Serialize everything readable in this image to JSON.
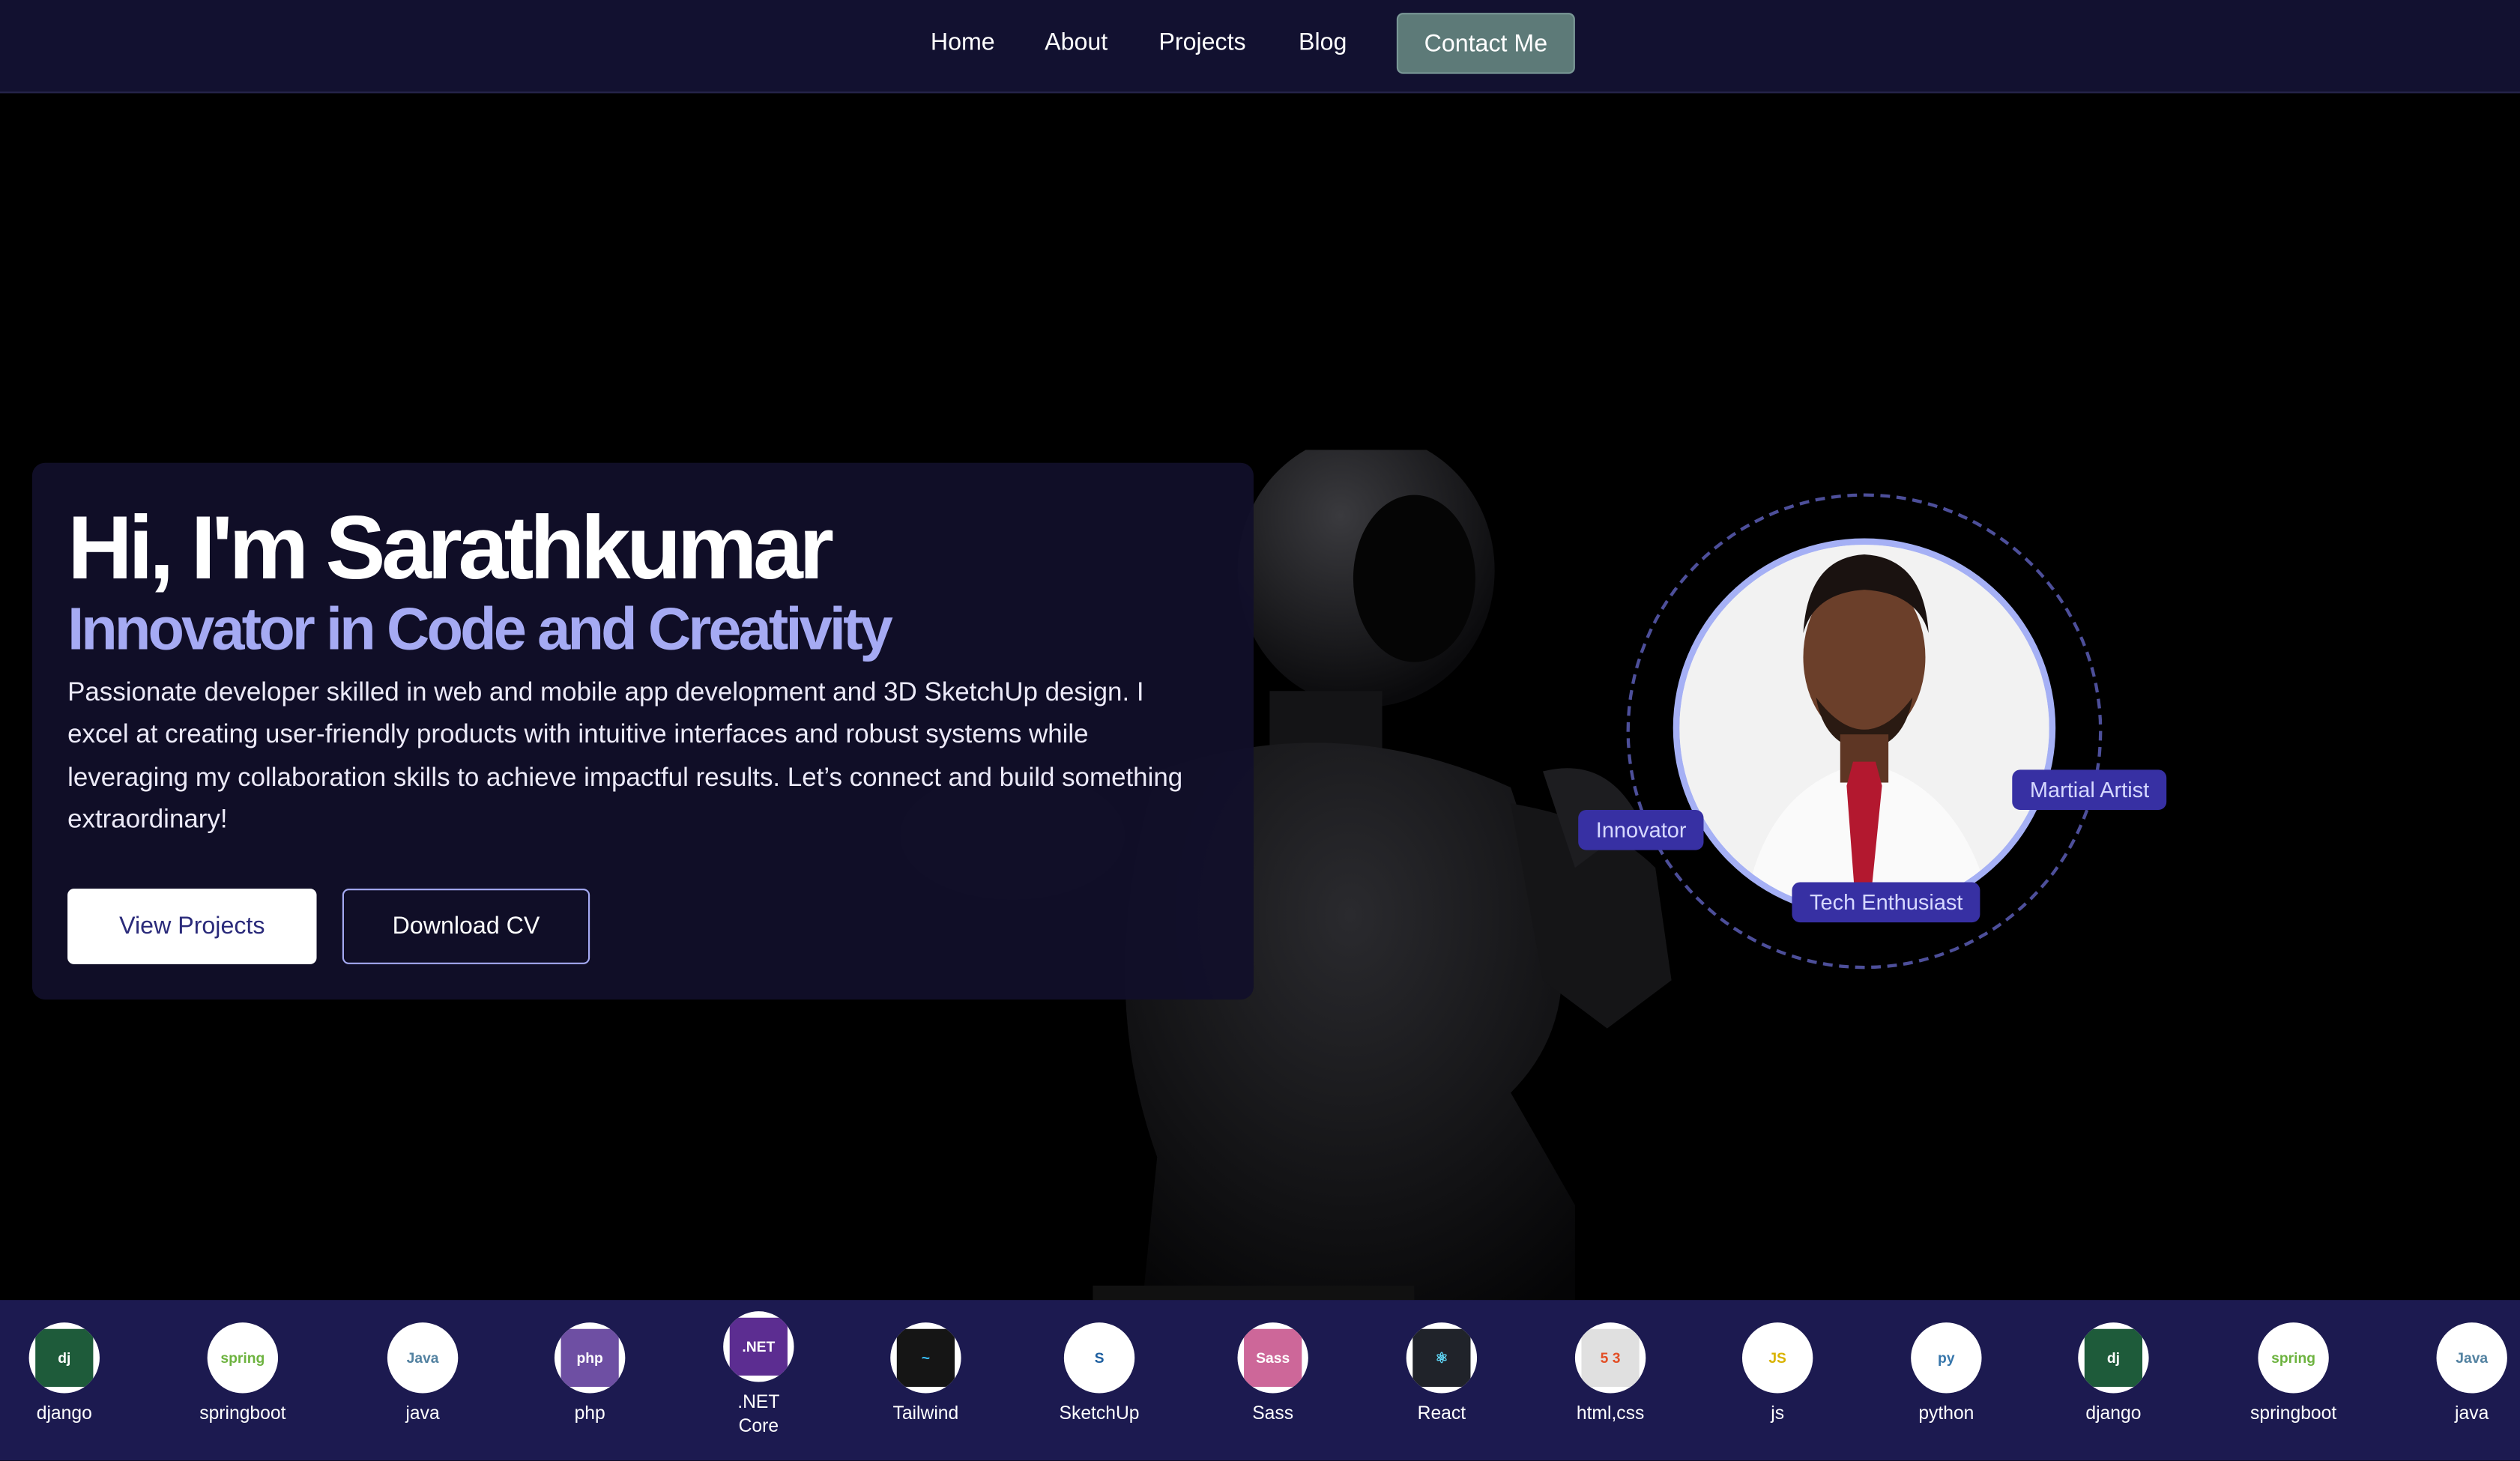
{
  "nav": {
    "items": [
      "Home",
      "About",
      "Projects",
      "Blog"
    ],
    "contact_label": "Contact Me"
  },
  "hero": {
    "title": "Hi, I'm Sarathkumar",
    "subtitle": "Innovator in Code and Creativity",
    "description": "Passionate developer skilled in web and mobile app development and 3D SketchUp design. I excel at creating user-friendly products with intuitive interfaces and robust systems while leveraging my collaboration skills to achieve impactful results. Let’s connect and build something extraordinary!",
    "view_projects_label": "View Projects",
    "download_cv_label": "Download CV"
  },
  "profile": {
    "badges": [
      "Innovator",
      "Tech Enthusiast",
      "Martial Artist"
    ]
  },
  "tech_stack": [
    {
      "label": "django",
      "icon": "django-icon",
      "mark": "dj",
      "bg": "#1e5b3a",
      "fg": "#ffffff"
    },
    {
      "label": "springboot",
      "icon": "springboot-icon",
      "mark": "spring",
      "bg": "#ffffff",
      "fg": "#6db33f"
    },
    {
      "label": "java",
      "icon": "java-icon",
      "mark": "Java",
      "bg": "#ffffff",
      "fg": "#5382a1"
    },
    {
      "label": "php",
      "icon": "php-icon",
      "mark": "php",
      "bg": "#6e4fa3",
      "fg": "#ffffff"
    },
    {
      "label": ".NET Core",
      "icon": "dotnet-icon",
      "mark": ".NET",
      "bg": "#5c2d91",
      "fg": "#ffffff"
    },
    {
      "label": "Tailwind",
      "icon": "tailwind-icon",
      "mark": "~",
      "bg": "#151515",
      "fg": "#38bdf8"
    },
    {
      "label": "SketchUp",
      "icon": "sketchup-icon",
      "mark": "S",
      "bg": "#ffffff",
      "fg": "#1e5fa0"
    },
    {
      "label": "Sass",
      "icon": "sass-icon",
      "mark": "Sass",
      "bg": "#cd6799",
      "fg": "#ffffff"
    },
    {
      "label": "React",
      "icon": "react-icon",
      "mark": "⚛",
      "bg": "#20232a",
      "fg": "#61dafb"
    },
    {
      "label": "html,css",
      "icon": "html-css-icon",
      "mark": "5 3",
      "bg": "#e0e0e0",
      "fg": "#e34f26"
    },
    {
      "label": "js",
      "icon": "javascript-icon",
      "mark": "JS",
      "bg": "#ffffff",
      "fg": "#d9b300"
    },
    {
      "label": "python",
      "icon": "python-icon",
      "mark": "py",
      "bg": "#ffffff",
      "fg": "#3776ab"
    },
    {
      "label": "django",
      "icon": "django-icon",
      "mark": "dj",
      "bg": "#1e5b3a",
      "fg": "#ffffff"
    },
    {
      "label": "springboot",
      "icon": "springboot-icon",
      "mark": "spring",
      "bg": "#ffffff",
      "fg": "#6db33f"
    },
    {
      "label": "java",
      "icon": "java-icon",
      "mark": "Java",
      "bg": "#ffffff",
      "fg": "#5382a1"
    }
  ],
  "colors": {
    "nav_bg": "#121130",
    "accent": "#a5aaf3",
    "badge_bg": "#3730a3",
    "strip_bg": "#1c1a50",
    "contact_bg": "#5d7a78"
  }
}
